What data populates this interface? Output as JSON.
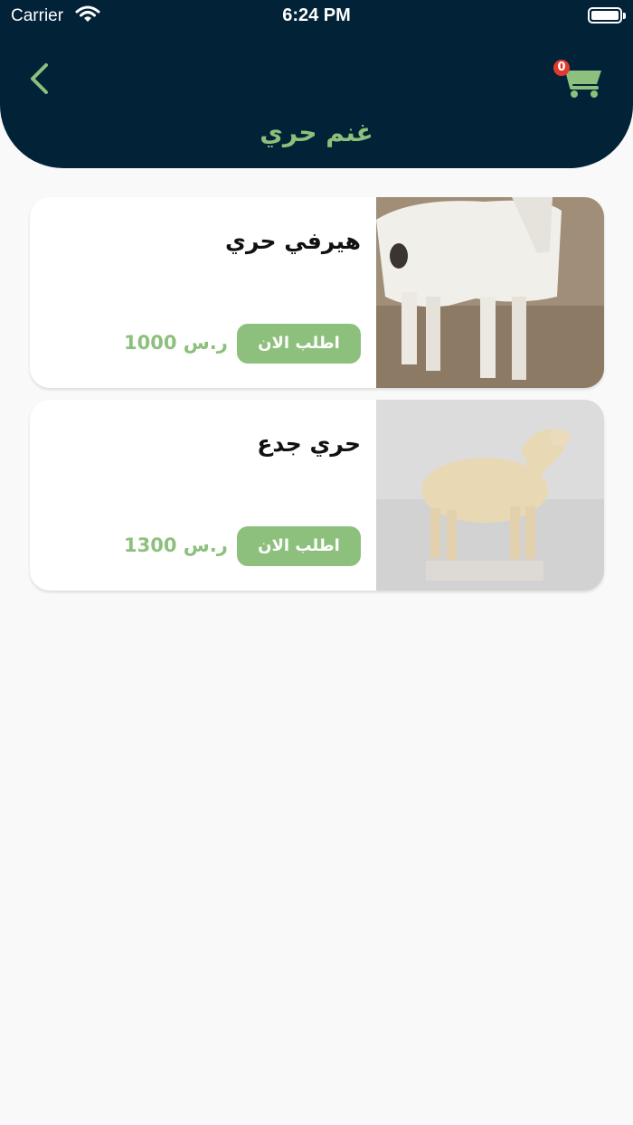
{
  "status_bar": {
    "carrier": "Carrier",
    "time": "6:24 PM"
  },
  "header": {
    "title": "غنم حري",
    "cart_count": "0"
  },
  "colors": {
    "header_bg": "#022238",
    "accent": "#8cc07c",
    "badge": "#e03a2f",
    "background": "#f9f9f9"
  },
  "icons": {
    "back": "chevron-left-icon",
    "cart": "cart-icon",
    "wifi": "wifi-icon",
    "battery": "battery-icon"
  },
  "products": [
    {
      "name": "هيرفي حري",
      "price": "1000 ر.س",
      "order_label": "اطلب الان",
      "image": "white-sheep-photo"
    },
    {
      "name": "حري جدع",
      "price": "1300 ر.س",
      "order_label": "اطلب الان",
      "image": "cream-sheep-photo"
    }
  ]
}
